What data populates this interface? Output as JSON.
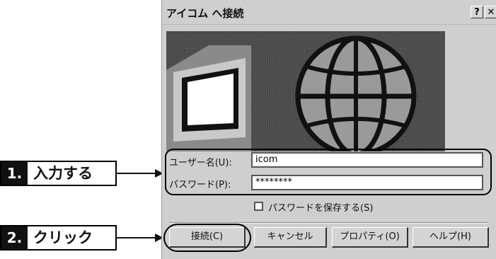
{
  "window": {
    "title": "アイコム へ接続",
    "help_btn": "?",
    "close_btn": "✕"
  },
  "form": {
    "username_label": "ユーザー名(U):",
    "username_value": "icom",
    "password_label": "パスワード(P):",
    "password_value": "********",
    "save_password_label": "パスワードを保存する(S)"
  },
  "buttons": {
    "connect": "接続(C)",
    "cancel": "キャンセル",
    "properties": "プロパティ(O)",
    "help": "ヘルプ(H)"
  },
  "callouts": [
    {
      "num": "1.",
      "text": "入力する"
    },
    {
      "num": "2.",
      "text": "クリック"
    }
  ]
}
